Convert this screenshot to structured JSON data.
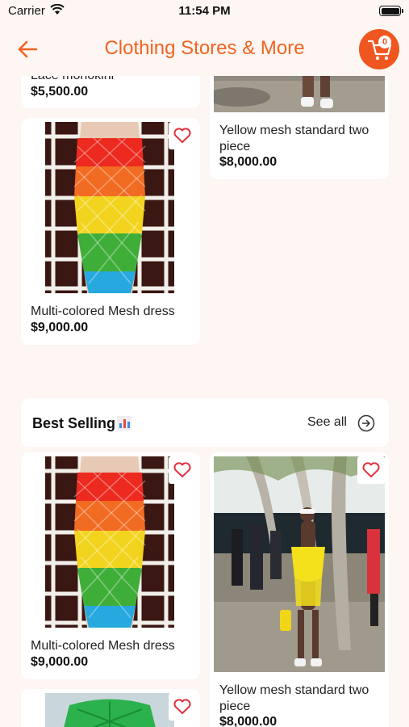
{
  "status_bar": {
    "carrier": "Carrier",
    "time": "11:54 PM"
  },
  "header": {
    "title": "Clothing Stores & More",
    "cart_count": "0"
  },
  "colors": {
    "accent": "#f0561f",
    "title": "#f06423",
    "heart": "#e0313f"
  },
  "products_top": [
    {
      "name": "Lace monokini",
      "price": "$5,500.00"
    },
    {
      "name": "Yellow mesh standard two piece",
      "price": "$8,000.00"
    },
    {
      "name": "Multi-colored Mesh dress",
      "price": "$9,000.00"
    }
  ],
  "best_selling": {
    "title": "Best Selling",
    "see_all_label": "See all",
    "products": [
      {
        "name": "Multi-colored Mesh dress",
        "price": "$9,000.00"
      },
      {
        "name": "Yellow mesh standard two piece",
        "price": "$8,000.00"
      }
    ]
  },
  "icons": [
    "back-arrow-icon",
    "cart-icon",
    "heart-icon",
    "bar-chart-icon",
    "arrow-circle-right-icon",
    "wifi-icon",
    "battery-icon"
  ]
}
